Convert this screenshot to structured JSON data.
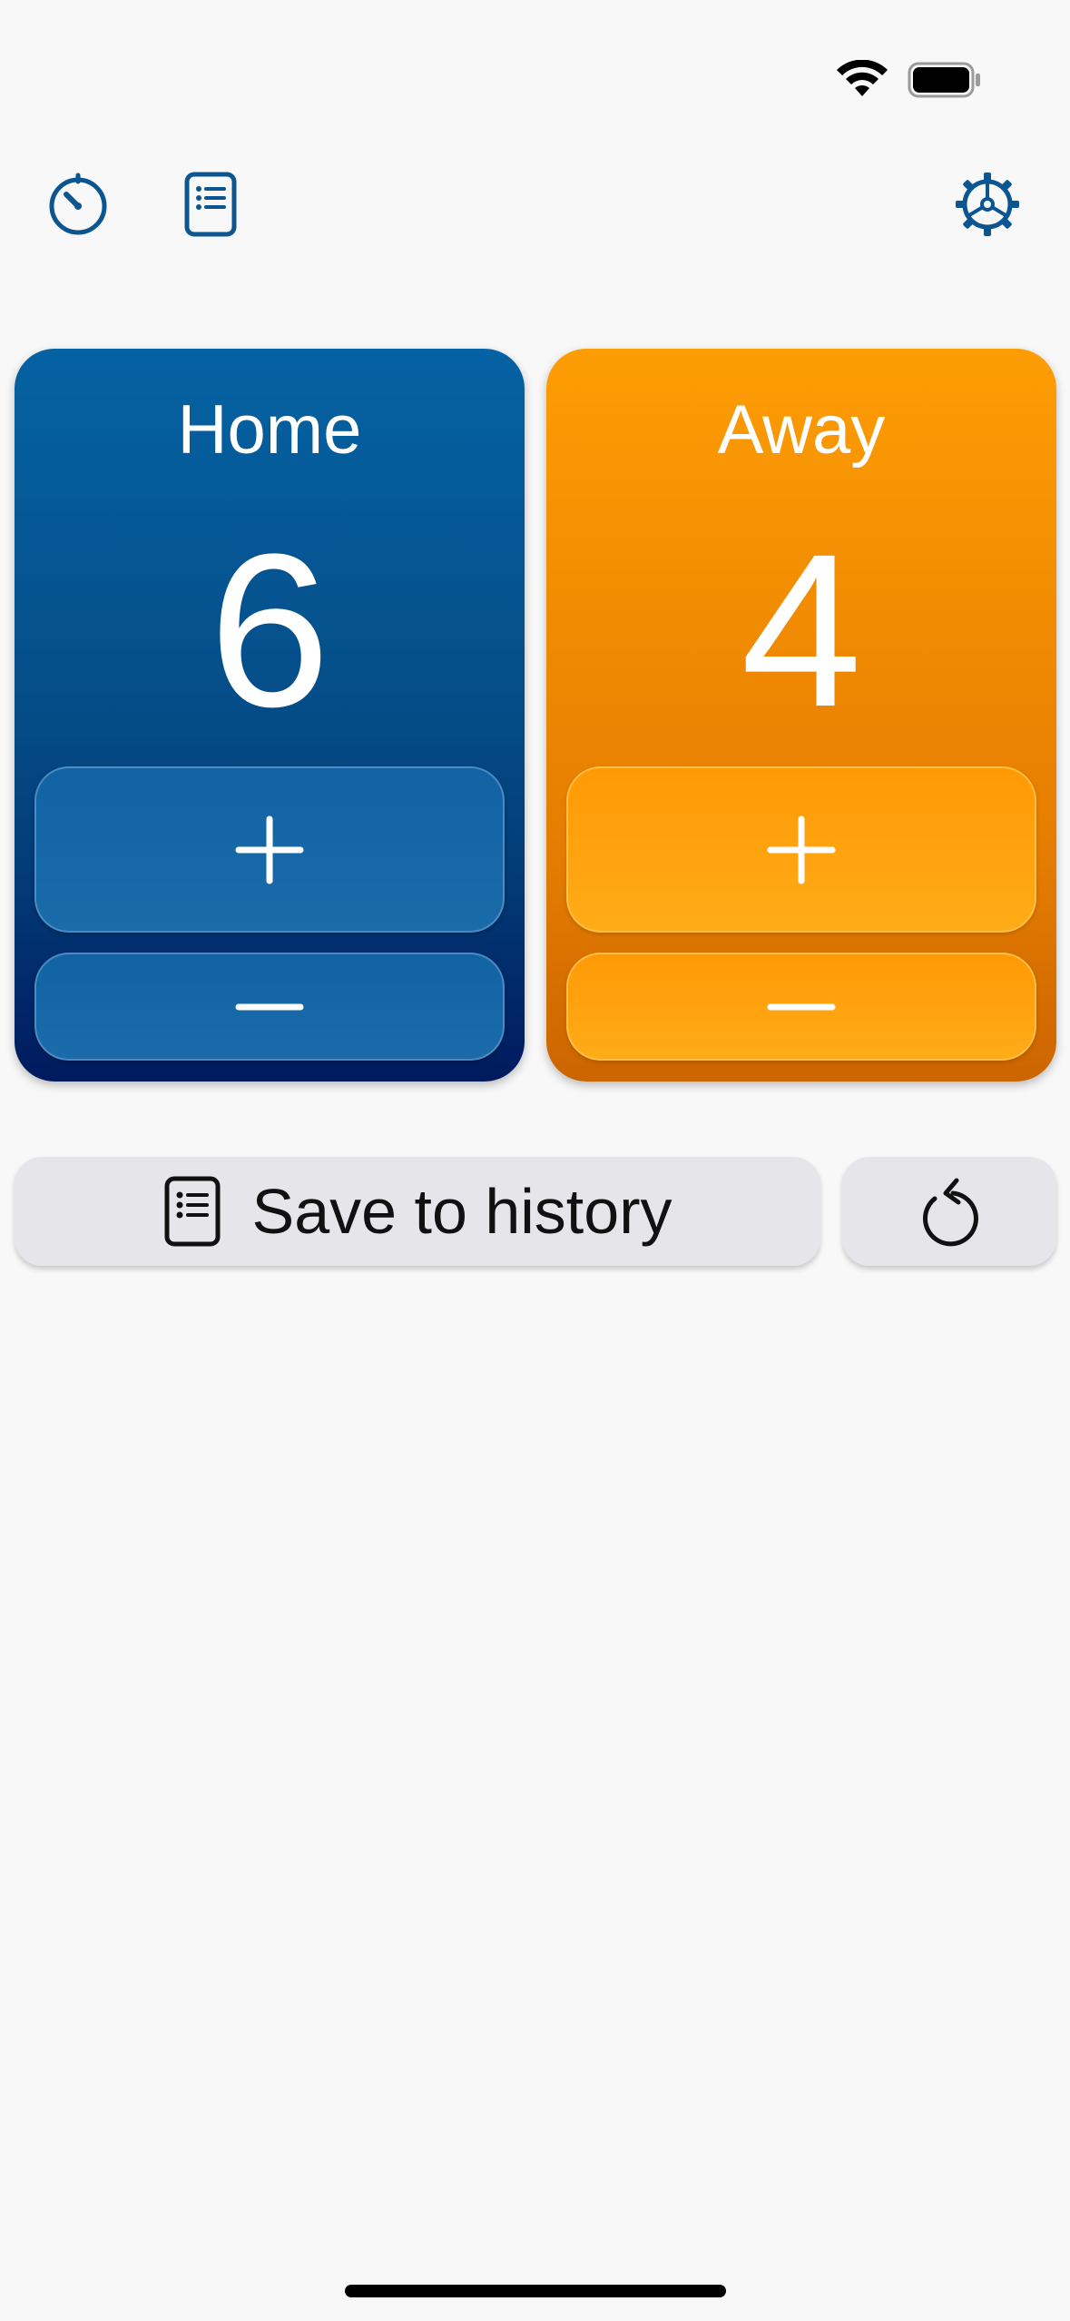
{
  "status_bar": {
    "wifi_icon": "wifi-icon",
    "battery_icon": "battery-icon"
  },
  "toolbar": {
    "timer_icon": "timer-icon",
    "history_list_icon": "list-icon",
    "settings_icon": "gear-icon"
  },
  "teams": {
    "home": {
      "name": "Home",
      "score": "6",
      "increment_label": "+",
      "decrement_label": "−",
      "color": "#0562a3"
    },
    "away": {
      "name": "Away",
      "score": "4",
      "increment_label": "+",
      "decrement_label": "−",
      "color": "#fd9d04"
    }
  },
  "actions": {
    "save_label": "Save to history",
    "save_icon": "list-icon",
    "reset_icon": "reset-icon"
  },
  "colors": {
    "toolbar_icon": "#0b5591",
    "background": "#f8f8f8",
    "button_gray": "#e6e6ea"
  }
}
